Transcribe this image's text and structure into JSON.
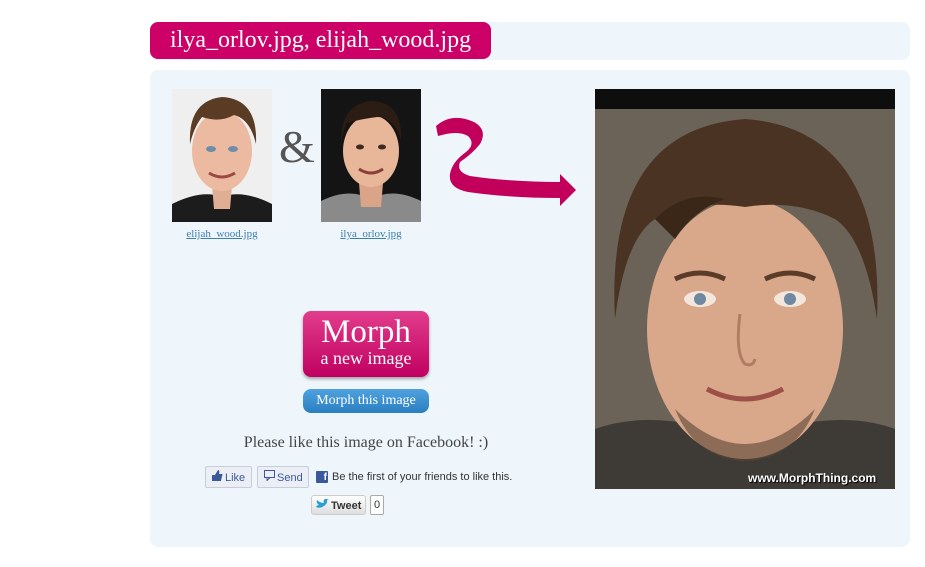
{
  "header": {
    "title": "ilya_orlov.jpg, elijah_wood.jpg"
  },
  "inputs": {
    "first_label": "elijah_wood.jpg",
    "second_label": "ilya_orlov.jpg",
    "joiner": "&"
  },
  "actions": {
    "morph_big": "Morph",
    "morph_small": "a new image",
    "morph_this": "Morph this image"
  },
  "social": {
    "prompt": "Please like this image on Facebook! :)",
    "like_label": "Like",
    "send_label": "Send",
    "fb_text": "Be the first of your friends to like this.",
    "tweet_label": "Tweet",
    "tweet_count": "0"
  },
  "result": {
    "watermark": "www.MorphThing.com"
  },
  "colors": {
    "accent": "#cc0066",
    "panel": "#eef6fc",
    "link": "#3d7fb0",
    "blue_button": "#2a7fc1"
  },
  "icons": [
    "thumbs-up-icon",
    "speech-bubble-icon",
    "facebook-icon",
    "twitter-bird-icon",
    "curved-arrow-icon"
  ]
}
